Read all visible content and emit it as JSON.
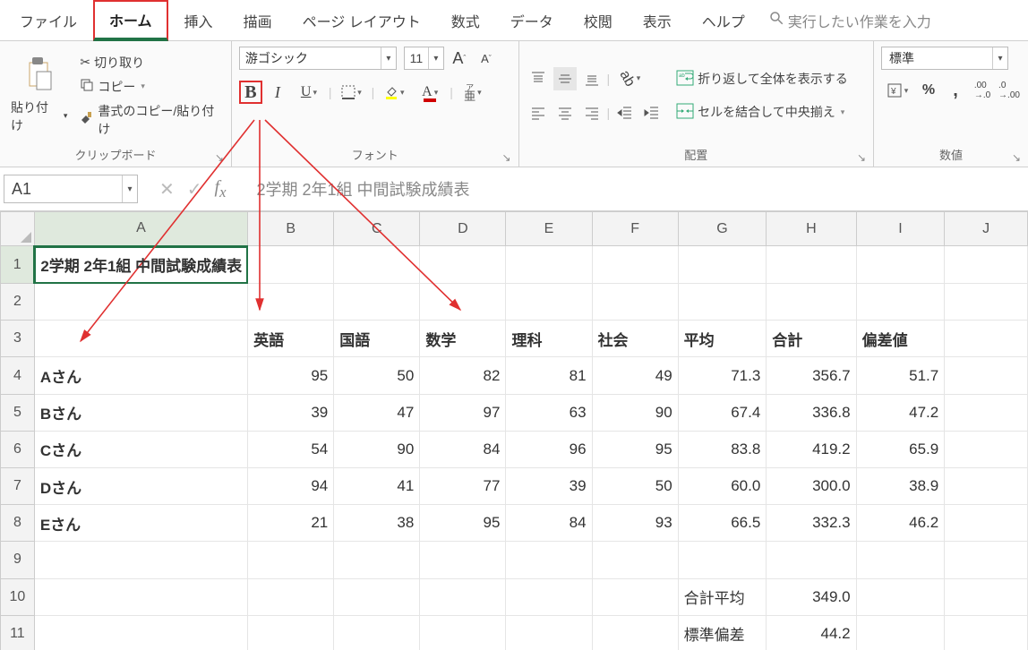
{
  "menu": {
    "tabs": [
      "ファイル",
      "ホーム",
      "挿入",
      "描画",
      "ページ レイアウト",
      "数式",
      "データ",
      "校閲",
      "表示",
      "ヘルプ"
    ],
    "active": "ホーム",
    "search_placeholder": "実行したい作業を入力"
  },
  "ribbon": {
    "clipboard": {
      "paste_label": "貼り付け",
      "cut_label": "切り取り",
      "copy_label": "コピー",
      "format_painter_label": "書式のコピー/貼り付け",
      "title": "クリップボード"
    },
    "font": {
      "name": "游ゴシック",
      "size": "11",
      "ruby_label": "ア\n亜",
      "title": "フォント"
    },
    "alignment": {
      "wrap_label": "折り返して全体を表示する",
      "merge_label": "セルを結合して中央揃え",
      "title": "配置"
    },
    "number": {
      "format": "標準",
      "title": "数値"
    }
  },
  "formula_bar": {
    "cell_ref": "A1",
    "formula": "2学期 2年1組 中間試験成績表"
  },
  "sheet": {
    "columns": [
      "A",
      "B",
      "C",
      "D",
      "E",
      "F",
      "G",
      "H",
      "I",
      "J"
    ],
    "rows": [
      "1",
      "2",
      "3",
      "4",
      "5",
      "6",
      "7",
      "8",
      "9",
      "10",
      "11"
    ],
    "active_cell": "A1",
    "title_row": "2学期 2年1組 中間試験成績表",
    "headers": [
      "",
      "英語",
      "国語",
      "数学",
      "理科",
      "社会",
      "平均",
      "合計",
      "偏差値"
    ],
    "data": [
      {
        "name": "Aさん",
        "v": [
          "95",
          "50",
          "82",
          "81",
          "49",
          "71.3",
          "356.7",
          "51.7"
        ]
      },
      {
        "name": "Bさん",
        "v": [
          "39",
          "47",
          "97",
          "63",
          "90",
          "67.4",
          "336.8",
          "47.2"
        ]
      },
      {
        "name": "Cさん",
        "v": [
          "54",
          "90",
          "84",
          "96",
          "95",
          "83.8",
          "419.2",
          "65.9"
        ]
      },
      {
        "name": "Dさん",
        "v": [
          "94",
          "41",
          "77",
          "39",
          "50",
          "60.0",
          "300.0",
          "38.9"
        ]
      },
      {
        "name": "Eさん",
        "v": [
          "21",
          "38",
          "95",
          "84",
          "93",
          "66.5",
          "332.3",
          "46.2"
        ]
      }
    ],
    "summary": [
      {
        "label": "合計平均",
        "value": "349.0"
      },
      {
        "label": "標準偏差",
        "value": "44.2"
      }
    ]
  }
}
